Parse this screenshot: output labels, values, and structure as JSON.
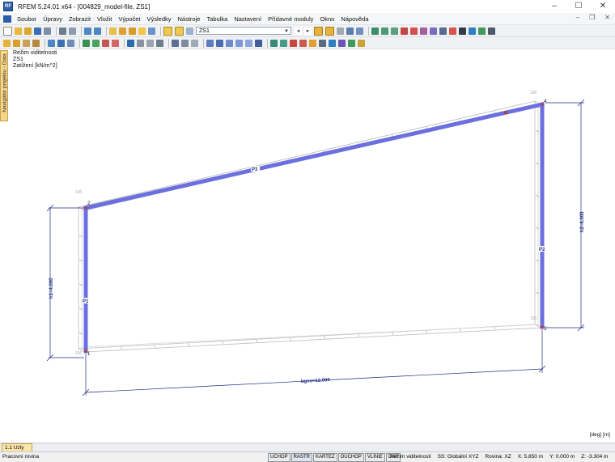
{
  "window": {
    "title": "RFEM 5.24.01 x64 - [004829_model-file, ZS1]",
    "app_icon": "RF",
    "minimize_icon": "–",
    "maximize_icon": "☐",
    "close_icon": "✕"
  },
  "menu": {
    "items": [
      "Soubor",
      "Úpravy",
      "Zobrazit",
      "Vložit",
      "Výpočet",
      "Výsledky",
      "Nástroje",
      "Tabulka",
      "Nastavení",
      "Přídavné moduly",
      "Okno",
      "Nápověda"
    ],
    "mdi_min": "–",
    "mdi_restore": "❐",
    "mdi_close": "✕"
  },
  "toolbar": {
    "load_case": "ZS1",
    "nav_prev": "◂",
    "nav_next": "▸"
  },
  "navigator": {
    "label": "Navigátor projektu - Data"
  },
  "viewport": {
    "info_lines": [
      "Režim viditelnosti",
      "ZS1",
      "Zatížení [kN/m^2]"
    ],
    "units": "[deg] [m]",
    "node_labels": [
      "1",
      "2",
      "3",
      "4"
    ],
    "member_labels": [
      "P1",
      "P2",
      "P3"
    ],
    "dimensions": {
      "height_left": "h1=4.000",
      "height_right": "h2=6.000",
      "width": "bges=12.000"
    },
    "load_values": [
      "100",
      "100",
      "100",
      "100"
    ]
  },
  "bottom_tabs": [
    "1.1 Uzly"
  ],
  "status": {
    "left": "Pracovní rovina",
    "toggles": [
      {
        "label": "UCHOP",
        "active": false
      },
      {
        "label": "RASTR",
        "active": true
      },
      {
        "label": "KARTEZ",
        "active": false
      },
      {
        "label": "OUCHOP",
        "active": false
      },
      {
        "label": "VLINIE",
        "active": false
      },
      {
        "label": "DXF",
        "active": false
      }
    ],
    "visibility_mode": "Režim viditelnosti",
    "coord_system": "SS: Globální XYZ",
    "plane": "Rovina: XZ",
    "x": "X:  5.850 m",
    "y": "Y:  0.000 m",
    "z": "Z:  -3.304 m"
  },
  "colors": {
    "member_blue": "#6b6fe0",
    "dimension_blue": "#1d2a80",
    "node_red": "#c0392b"
  }
}
